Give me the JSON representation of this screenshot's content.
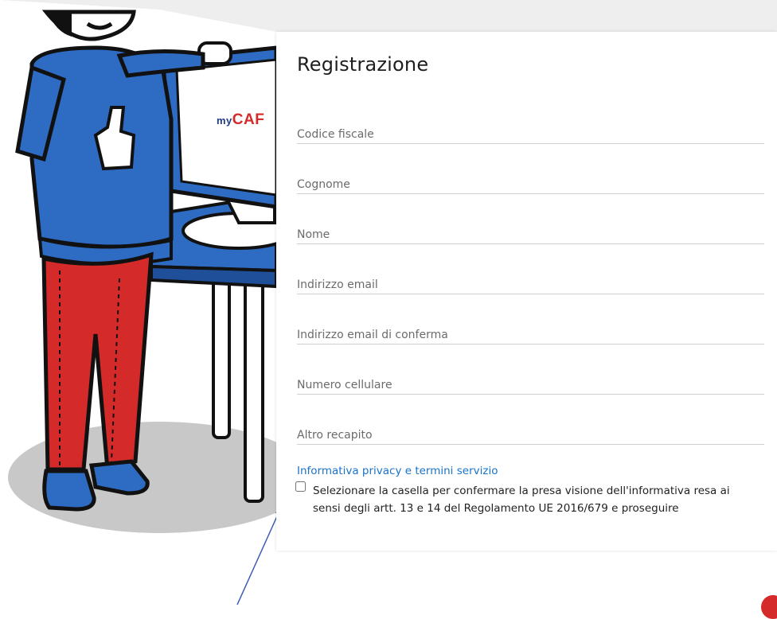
{
  "brand": {
    "logo_prefix": "my",
    "logo_main": "CAF"
  },
  "form": {
    "title": "Registrazione",
    "fields": [
      {
        "placeholder": "Codice fiscale",
        "value": ""
      },
      {
        "placeholder": "Cognome",
        "value": ""
      },
      {
        "placeholder": "Nome",
        "value": ""
      },
      {
        "placeholder": "Indirizzo email",
        "value": ""
      },
      {
        "placeholder": "Indirizzo email di conferma",
        "value": ""
      },
      {
        "placeholder": "Numero cellulare",
        "value": ""
      },
      {
        "placeholder": "Altro recapito",
        "value": ""
      }
    ],
    "privacy_link": "Informativa privacy e termini servizio",
    "consent_text": "Selezionare la casella per confermare la presa visione dell'informativa resa ai sensi degli artt. 13 e 14 del Regolamento UE 2016/679 e proseguire",
    "consent_checked": false
  },
  "colors": {
    "link": "#1a73c8",
    "accent_red": "#d42a2a",
    "shirt_blue": "#2e6cc4",
    "pants_red": "#d42a2a",
    "annotation_arrow": "#3b5bb5"
  }
}
